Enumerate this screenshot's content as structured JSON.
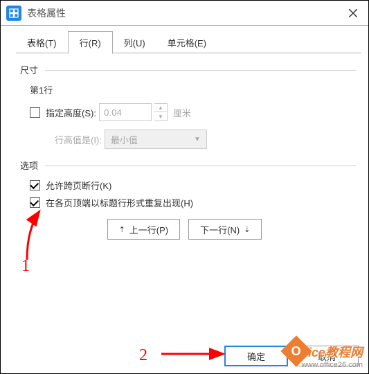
{
  "titlebar": {
    "title": "表格属性"
  },
  "tabs": [
    {
      "label": "表格(T)"
    },
    {
      "label": "行(R)"
    },
    {
      "label": "列(U)"
    },
    {
      "label": "单元格(E)"
    }
  ],
  "section_size": {
    "legend": "尺寸",
    "row_label": "第1行",
    "specify_height_label": "指定高度(S):",
    "height_value": "0.04",
    "height_unit": "厘米",
    "row_height_is_label": "行高值是(I):",
    "row_height_is_value": "最小值"
  },
  "section_options": {
    "legend": "选项",
    "allow_break_label": "允许跨页断行(K)",
    "repeat_header_label": "在各页顶端以标题行形式重复出现(H)"
  },
  "nav": {
    "prev": "上一行(P)",
    "next": "下一行(N)"
  },
  "footer": {
    "ok": "确定",
    "cancel": "取消"
  },
  "annotations": {
    "a1": "1",
    "a2": "2"
  },
  "watermark": {
    "line1": "Office教程网",
    "line2": "www.office26.com"
  }
}
